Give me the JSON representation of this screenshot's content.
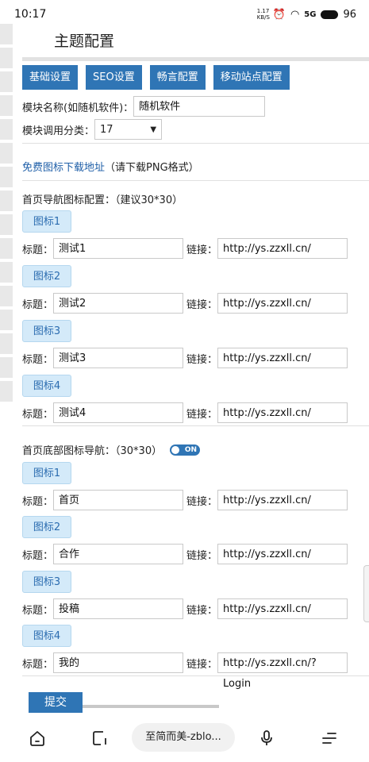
{
  "status_bar": {
    "time": "10:17",
    "speed": "1.17 KB/S",
    "signal_text": "5G",
    "battery": "96"
  },
  "page": {
    "title": "主题配置"
  },
  "tabs": [
    "基础设置",
    "SEO设置",
    "畅言配置",
    "移动站点配置"
  ],
  "module": {
    "name_label": "模块名称(如随机软件)：",
    "name_value": "随机软件",
    "category_label": "模块调用分类：",
    "category_value": "17"
  },
  "free_icons": {
    "link_text": "免费图标下载地址",
    "note": "（请下载PNG格式）"
  },
  "labels": {
    "title": "标题：",
    "link": "链接："
  },
  "top_nav": {
    "heading": "首页导航图标配置：（建议30*30）",
    "items": [
      {
        "button": "图标1",
        "title": "测试1",
        "link": "http://ys.zzxll.cn/"
      },
      {
        "button": "图标2",
        "title": "测试2",
        "link": "http://ys.zzxll.cn/"
      },
      {
        "button": "图标3",
        "title": "测试3",
        "link": "http://ys.zzxll.cn/"
      },
      {
        "button": "图标4",
        "title": "测试4",
        "link": "http://ys.zzxll.cn/"
      }
    ]
  },
  "bottom_nav": {
    "heading": "首页底部图标导航：（30*30）",
    "toggle_label": "ON",
    "items": [
      {
        "button": "图标1",
        "title": "首页",
        "link": "http://ys.zzxll.cn/"
      },
      {
        "button": "图标2",
        "title": "合作",
        "link": "http://ys.zzxll.cn/"
      },
      {
        "button": "图标3",
        "title": "投稿",
        "link": "http://ys.zzxll.cn/"
      },
      {
        "button": "图标4",
        "title": "我的",
        "link": "http://ys.zzxll.cn/?Login"
      }
    ]
  },
  "submit_label": "提交",
  "navbar": {
    "address": "至简而美-zblo..."
  },
  "colors": {
    "accent": "#2f75b5",
    "icon_button_bg": "#d4eaf9",
    "link": "#1f5fa8"
  },
  "icons": [
    "home-icon",
    "tabs-icon",
    "microphone-icon",
    "menu-icon",
    "wifi-icon",
    "alarm-icon",
    "battery-icon"
  ]
}
